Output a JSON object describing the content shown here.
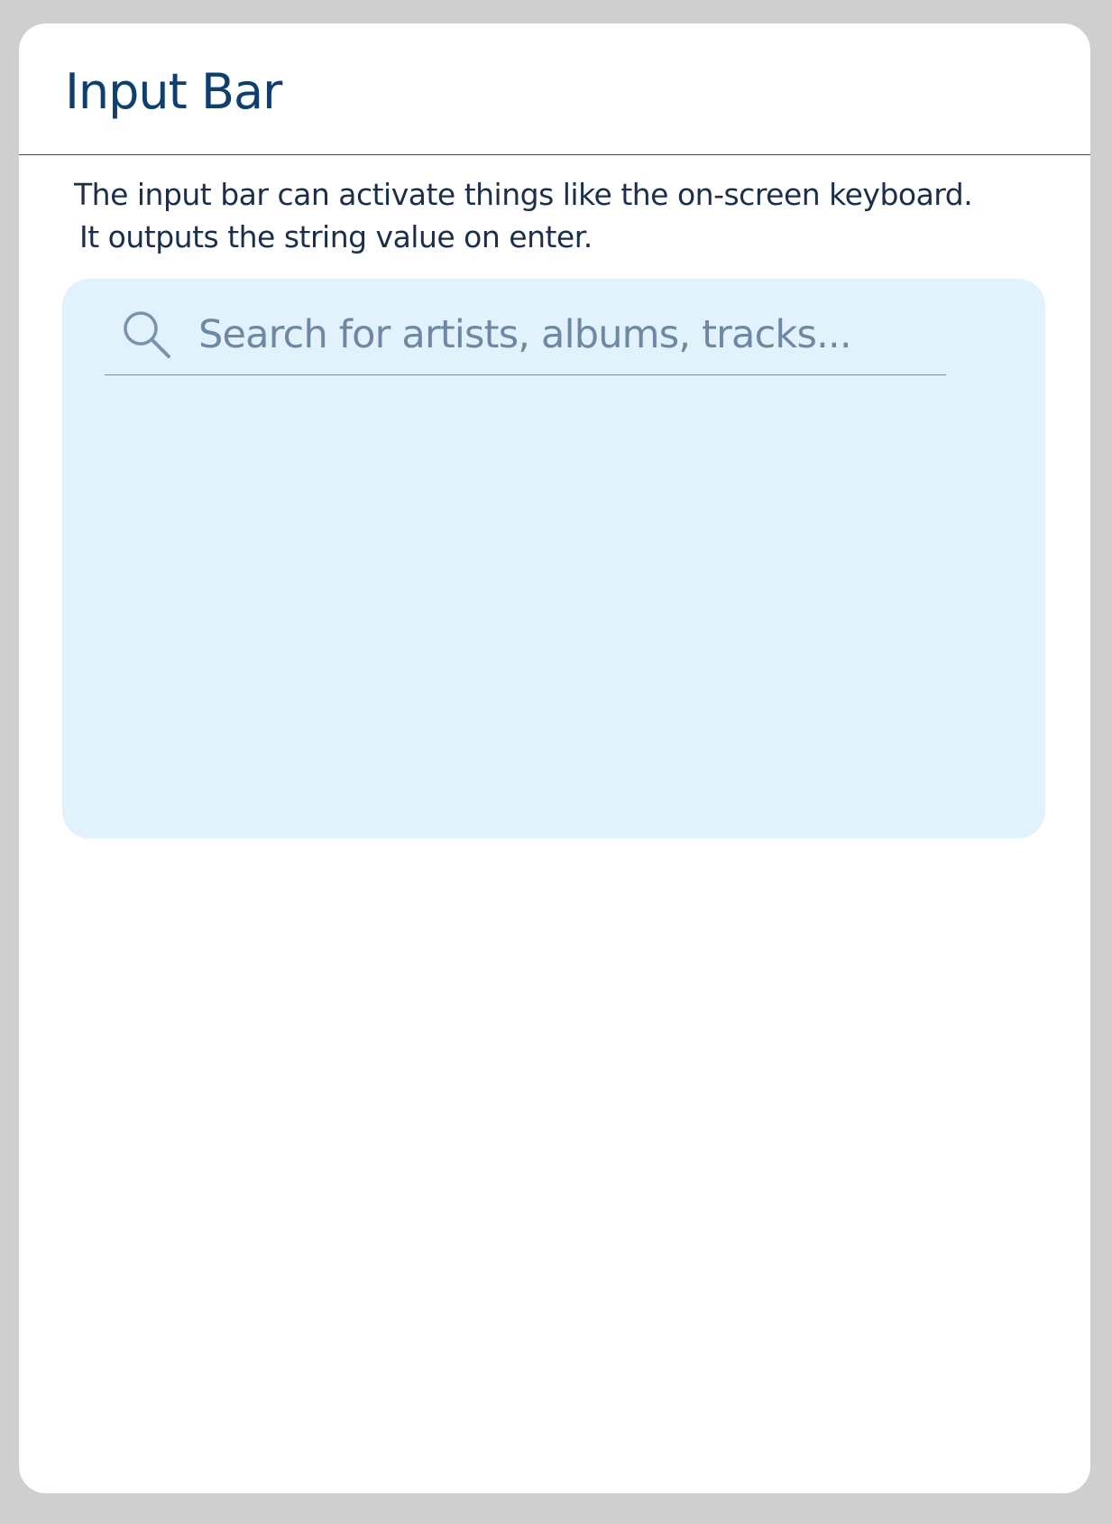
{
  "card": {
    "title": "Input Bar",
    "description_line1": "The input bar can activate things like the on-screen keyboard.",
    "description_line2": "It outputs the string value on enter."
  },
  "input_bar": {
    "icon": "search-icon",
    "value": "",
    "placeholder": "Search for artists, albums, tracks..."
  },
  "colors": {
    "page_background": "#cfcfcf",
    "card_background": "#ffffff",
    "title_color": "#0f3f6e",
    "text_color": "#1b2e4a",
    "panel_background": "#e1f2fd",
    "placeholder_color": "#6e88a3"
  }
}
